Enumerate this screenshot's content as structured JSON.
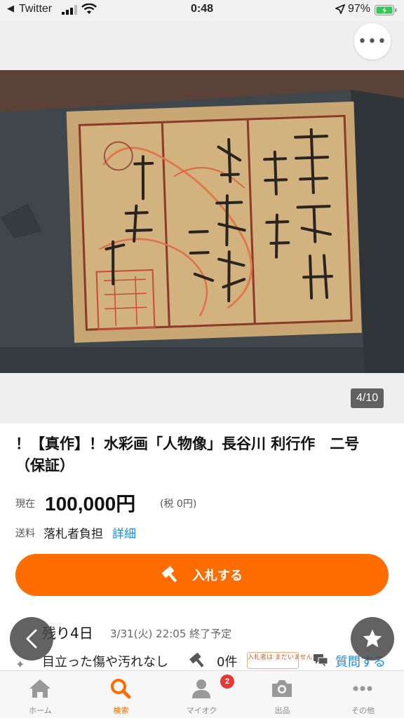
{
  "status_bar": {
    "back_app": "Twitter",
    "time": "0:48",
    "battery": "97%"
  },
  "gallery": {
    "counter": "4/10"
  },
  "item": {
    "title": "！【真作】！水彩画「人物像」長谷川 利行作　二号（保証）",
    "price_label": "現在",
    "price": "100,000円",
    "tax": "(税 0円)",
    "shipping_label": "送料",
    "shipping_value": "落札者負担",
    "shipping_link": "詳細"
  },
  "actions": {
    "bid_button": "入札する"
  },
  "auction": {
    "remaining": "残り4日",
    "end_date": "3/31(火) 22:05 終了予定",
    "condition": "目立った傷や汚れなし",
    "bid_count": "0件",
    "no_bids_badge": "入札者は まだいません！",
    "question": "質問する"
  },
  "tabbar": {
    "items": [
      {
        "label": "ホーム",
        "icon": "home-icon"
      },
      {
        "label": "検索",
        "icon": "search-icon"
      },
      {
        "label": "マイオク",
        "icon": "person-icon"
      },
      {
        "label": "出品",
        "icon": "camera-icon"
      },
      {
        "label": "その他",
        "icon": "more-icon"
      }
    ],
    "active_index": 1,
    "myauc_badge": "2"
  },
  "colors": {
    "accent": "#ff6d00",
    "link": "#1e88e5",
    "badge": "#e53935"
  }
}
